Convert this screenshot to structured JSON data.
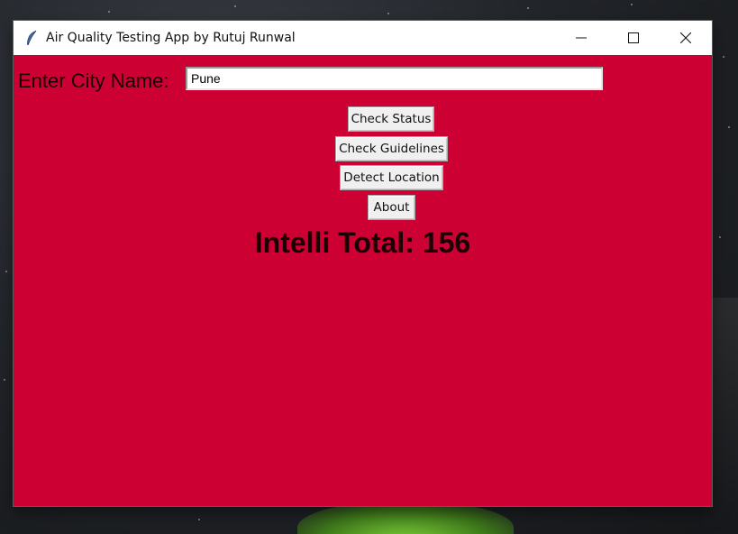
{
  "window": {
    "title": "Air Quality Testing App by Rutuj Runwal",
    "app_icon": "feather-icon",
    "controls": {
      "minimize_icon": "minimize-icon",
      "maximize_icon": "maximize-icon",
      "close_icon": "close-icon"
    },
    "background_color": "#cc0033"
  },
  "form": {
    "city_label": "Enter City Name:",
    "city_value": "Pune"
  },
  "buttons": {
    "check_status": "Check Status",
    "check_guidelines": "Check Guidelines",
    "detect_location": "Detect Location",
    "about": "About"
  },
  "result": {
    "text": "Intelli Total: 156"
  }
}
